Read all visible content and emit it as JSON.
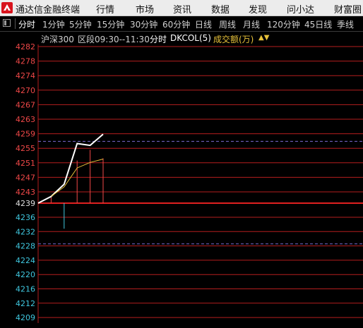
{
  "app": {
    "title": "通达信金融终端"
  },
  "menu": [
    "行情",
    "市场",
    "资讯",
    "数据",
    "发现",
    "问小达",
    "财富圈"
  ],
  "periods": {
    "items": [
      "分时",
      "1分钟",
      "5分钟",
      "15分钟",
      "30分钟",
      "60分钟",
      "日线",
      "周线",
      "月线",
      "120分钟",
      "45日线",
      "季线"
    ],
    "active_index": 0
  },
  "info": {
    "index": "沪深300",
    "range": "区段09:30--11:30",
    "mode": "分时",
    "indicator": "DKCOL(5)",
    "metric": "成交额(万)"
  },
  "colors": {
    "up": "#f04848",
    "down": "#40c8e0",
    "grid": "#b41e1e",
    "price_line": "#ffffff",
    "avg_line": "#e8c23a",
    "background": "#000000"
  },
  "chart_data": {
    "type": "line",
    "y_ticks_upper": [
      "4282",
      "4278",
      "4274",
      "4270",
      "4267",
      "4263",
      "4259",
      "4255",
      "4251",
      "4247",
      "4243"
    ],
    "base_label": "4239",
    "y_ticks_lower": [
      "4236",
      "4232",
      "4228",
      "4224",
      "4220",
      "4216",
      "4212",
      "4209"
    ],
    "base_value": 4239.4,
    "price_series": [
      4241.2,
      4244.5,
      4255.5,
      4255.0,
      4258.0
    ],
    "avg_series": [
      4241.2,
      4243.8,
      4248.9,
      4250.4,
      4251.3
    ],
    "volume_bars": [
      {
        "min": 4239.5,
        "value": 4241.2,
        "color": "up"
      },
      {
        "min": 4232.5,
        "value": 4239.4,
        "color": "down"
      },
      {
        "min": 4239.4,
        "value": 4250.9,
        "color": "up"
      },
      {
        "min": 4239.4,
        "value": 4253.8,
        "color": "up"
      },
      {
        "min": 4239.4,
        "value": 4251.5,
        "color": "up"
      }
    ],
    "dashed_lines": [
      4256.1,
      4228.4
    ]
  }
}
